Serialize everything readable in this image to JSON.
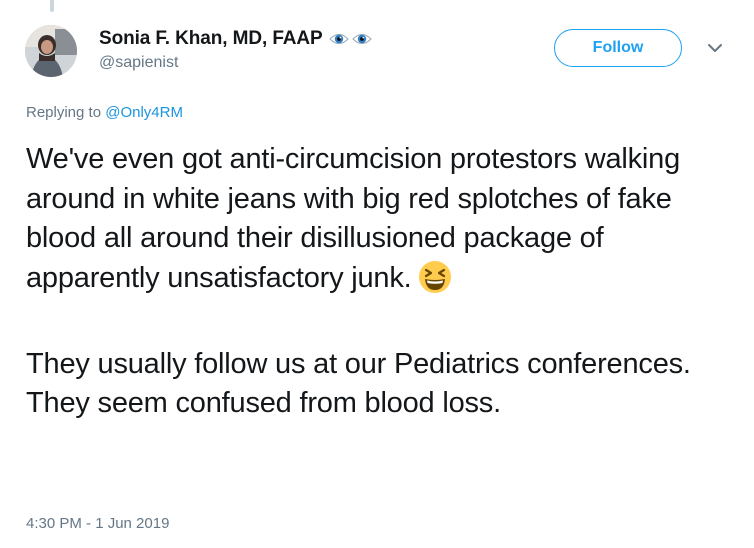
{
  "author": {
    "display_name": "Sonia F. Khan, MD, FAAP",
    "name_emoji": "eye-icon",
    "handle": "@sapienist"
  },
  "follow_button": {
    "label": "Follow"
  },
  "caret_icon": "chevron-down-icon",
  "reply_context": {
    "prefix": "Replying to",
    "mention": "@Only4RM"
  },
  "tweet": {
    "paragraph_1": "We've even got anti-circumcision protestors walking around in white jeans with big red splotches of fake blood all around their disillusioned package of apparently unsatisfactory junk.",
    "emoji": "grinning-squinting-face-icon",
    "paragraph_2": "They usually follow us at our Pediatrics conferences. They seem confused from blood loss."
  },
  "timestamp": "4:30 PM - 1 Jun 2019",
  "colors": {
    "accent": "#1da1f2",
    "link": "#1b95e0",
    "secondary_text": "#657786",
    "primary_text": "#14171a",
    "thread_line": "#ccd6dd"
  }
}
